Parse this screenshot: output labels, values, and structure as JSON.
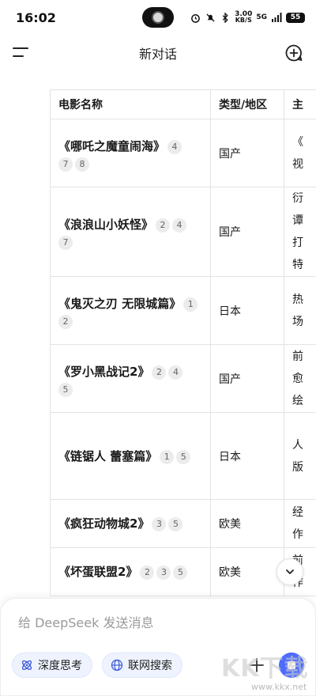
{
  "status": {
    "time": "16:02",
    "speed_value": "3.00",
    "speed_unit": "KB/S",
    "network": "5G",
    "battery": "55"
  },
  "header": {
    "title": "新对话"
  },
  "table": {
    "headers": [
      "电影名称",
      "类型/地区",
      "主"
    ],
    "rows": [
      {
        "name": "《哪吒之魔童闹海》",
        "refs": [
          "4",
          "7",
          "8"
        ],
        "type": "国产",
        "desc": "《\n视"
      },
      {
        "name": "《浪浪山小妖怪》",
        "refs": [
          "2",
          "4",
          "7"
        ],
        "type": "国产",
        "desc": "衍\n谭\n打\n特"
      },
      {
        "name": "《鬼灭之刃 无限城篇》",
        "refs": [
          "1",
          "2"
        ],
        "type": "日本",
        "desc": "热\n场"
      },
      {
        "name": "《罗小黑战记2》",
        "refs": [
          "2",
          "4",
          "5"
        ],
        "type": "国产",
        "desc": "前\n愈\n绘"
      },
      {
        "name": "《链锯人 蕾塞篇》",
        "refs": [
          "1",
          "5"
        ],
        "type": "日本",
        "desc": "人\n版"
      },
      {
        "name": "《疯狂动物城2》",
        "refs": [
          "3",
          "5"
        ],
        "type": "欧美",
        "desc": "经\n作"
      },
      {
        "name": "《坏蛋联盟2》",
        "refs": [
          "2",
          "3",
          "5"
        ],
        "type": "欧美",
        "desc": "前\n作"
      }
    ]
  },
  "composer": {
    "placeholder": "给 DeepSeek 发送消息",
    "deep_think_label": "深度思考",
    "web_search_label": "联网搜索"
  },
  "watermark": {
    "text": "KK下载",
    "url": "www.kkx.net"
  },
  "colors": {
    "accent": "#4d6bfe",
    "chip_bg": "#eef3ff",
    "ref_bg": "#ececec"
  }
}
